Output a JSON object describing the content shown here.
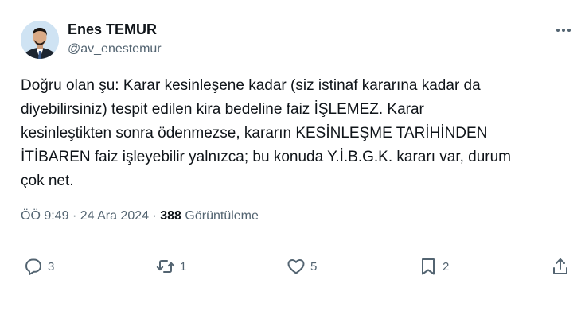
{
  "author": {
    "name": "Enes TEMUR",
    "handle": "@av_enestemur"
  },
  "tweet": {
    "text": "Doğru olan şu: Karar kesinleşene kadar (siz istinaf kararına kadar da\ndiyebilirsiniz) tespit edilen kira bedeline faiz İŞLEMEZ. Karar\nkesinleştikten sonra ödenmezse, kararın KESİNLEŞME TARİHİNDEN\nİTİBAREN faiz işleyebilir yalnızca; bu konuda Y.İ.B.G.K. kararı var, durum\nçok net.",
    "time": "ÖÖ 9:49",
    "date": "24 Ara 2024",
    "separator": "·",
    "views_count": "388",
    "views_label": "Görüntüleme"
  },
  "actions": {
    "replies": "3",
    "reposts": "1",
    "likes": "5",
    "bookmarks": "2"
  },
  "icons": {
    "more": "more-dots-icon",
    "reply": "reply-icon",
    "repost": "repost-icon",
    "like": "heart-icon",
    "bookmark": "bookmark-icon",
    "share": "share-icon"
  },
  "colors": {
    "text": "#0f1419",
    "secondary": "#536471"
  }
}
